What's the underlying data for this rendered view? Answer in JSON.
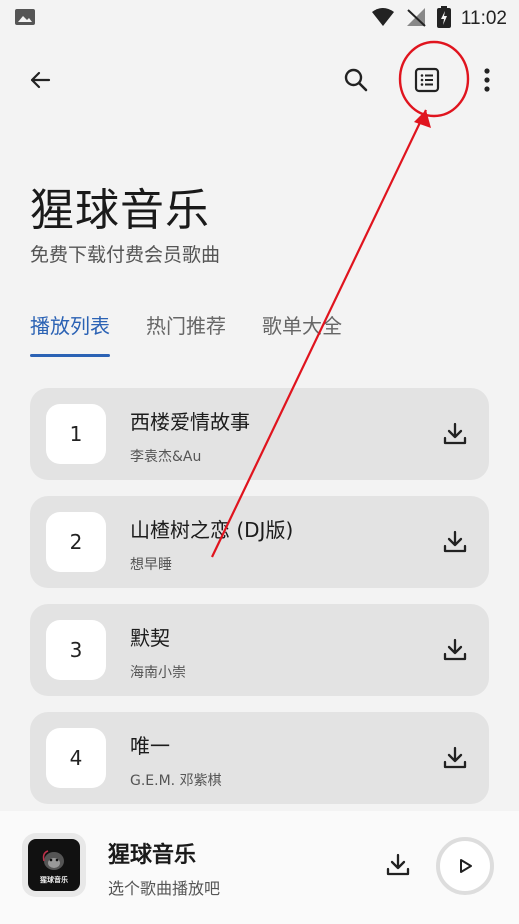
{
  "status_bar": {
    "time": "11:02"
  },
  "header": {
    "title": "猩球音乐",
    "subtitle": "免费下载付费会员歌曲"
  },
  "tabs": [
    {
      "label": "播放列表",
      "active": true
    },
    {
      "label": "热门推荐",
      "active": false
    },
    {
      "label": "歌单大全",
      "active": false
    }
  ],
  "songs": [
    {
      "index": "1",
      "title": "西楼爱情故事",
      "artist": "李袁杰&Au"
    },
    {
      "index": "2",
      "title": "山楂树之恋 (DJ版)",
      "artist": "想早睡"
    },
    {
      "index": "3",
      "title": "默契",
      "artist": "海南小崇"
    },
    {
      "index": "4",
      "title": "唯一",
      "artist": "G.E.M. 邓紫棋"
    }
  ],
  "player": {
    "title": "猩球音乐",
    "subtitle": "选个歌曲播放吧",
    "cover_text": "猩球音乐"
  },
  "colors": {
    "accent": "#2b62b4",
    "annotation": "#e0141e"
  }
}
